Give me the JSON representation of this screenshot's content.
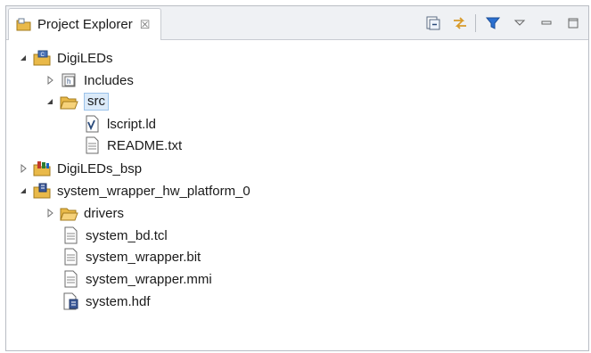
{
  "view": {
    "title": "Project Explorer",
    "close_glyph": "☒"
  },
  "toolbar": {
    "buttons": [
      "collapse-all-icon",
      "link-with-editor-icon",
      "filter-icon",
      "view-menu-icon",
      "minimize-icon",
      "maximize-icon"
    ]
  },
  "tree": {
    "digileds": {
      "label": "DigiLEDs",
      "expanded": true
    },
    "includes": {
      "label": "Includes",
      "expanded": false
    },
    "src": {
      "label": "src",
      "expanded": true,
      "selected": true
    },
    "lscript": {
      "label": "lscript.ld"
    },
    "readme": {
      "label": "README.txt"
    },
    "bsp": {
      "label": "DigiLEDs_bsp",
      "expanded": false
    },
    "hw_platform": {
      "label": "system_wrapper_hw_platform_0",
      "expanded": true
    },
    "drivers": {
      "label": "drivers",
      "expanded": false
    },
    "system_bd": {
      "label": "system_bd.tcl"
    },
    "system_bit": {
      "label": "system_wrapper.bit"
    },
    "system_mmi": {
      "label": "system_wrapper.mmi"
    },
    "system_hdf": {
      "label": "system.hdf"
    }
  },
  "colors": {
    "folder": "#e9b949",
    "selection": "#dbeaf9",
    "filter": "#2a6fd0"
  }
}
